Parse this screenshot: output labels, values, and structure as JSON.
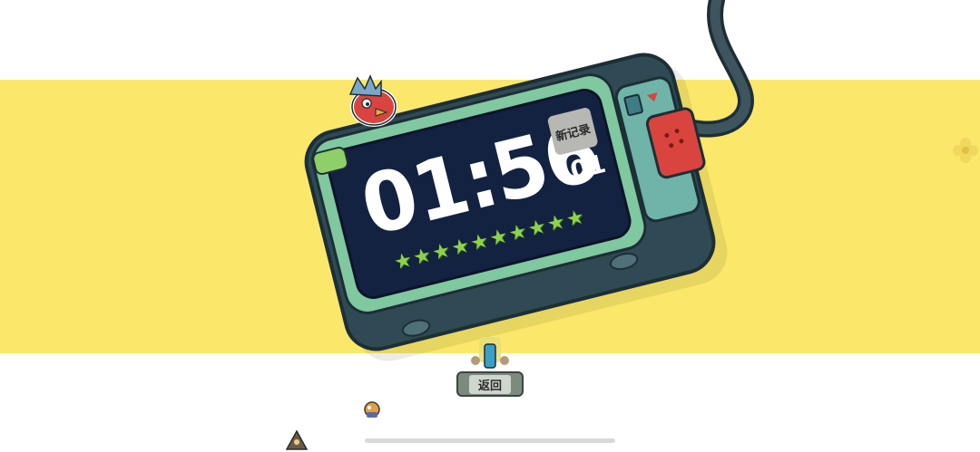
{
  "colors": {
    "band": "#fbe86a",
    "screen": "#142241",
    "device_body": "#2f4a55",
    "rim": "#7fc8a0",
    "star": "#8fd14a",
    "plug": "#d9443f"
  },
  "timer": {
    "main": "01:56",
    "fraction": ":01",
    "badge": "新记录",
    "stars_count": 10
  },
  "icons": {
    "star": "star-icon",
    "mascot": "red-bird-icon",
    "flower": "flower-icon"
  },
  "buttons": {
    "return_label": "返回"
  }
}
